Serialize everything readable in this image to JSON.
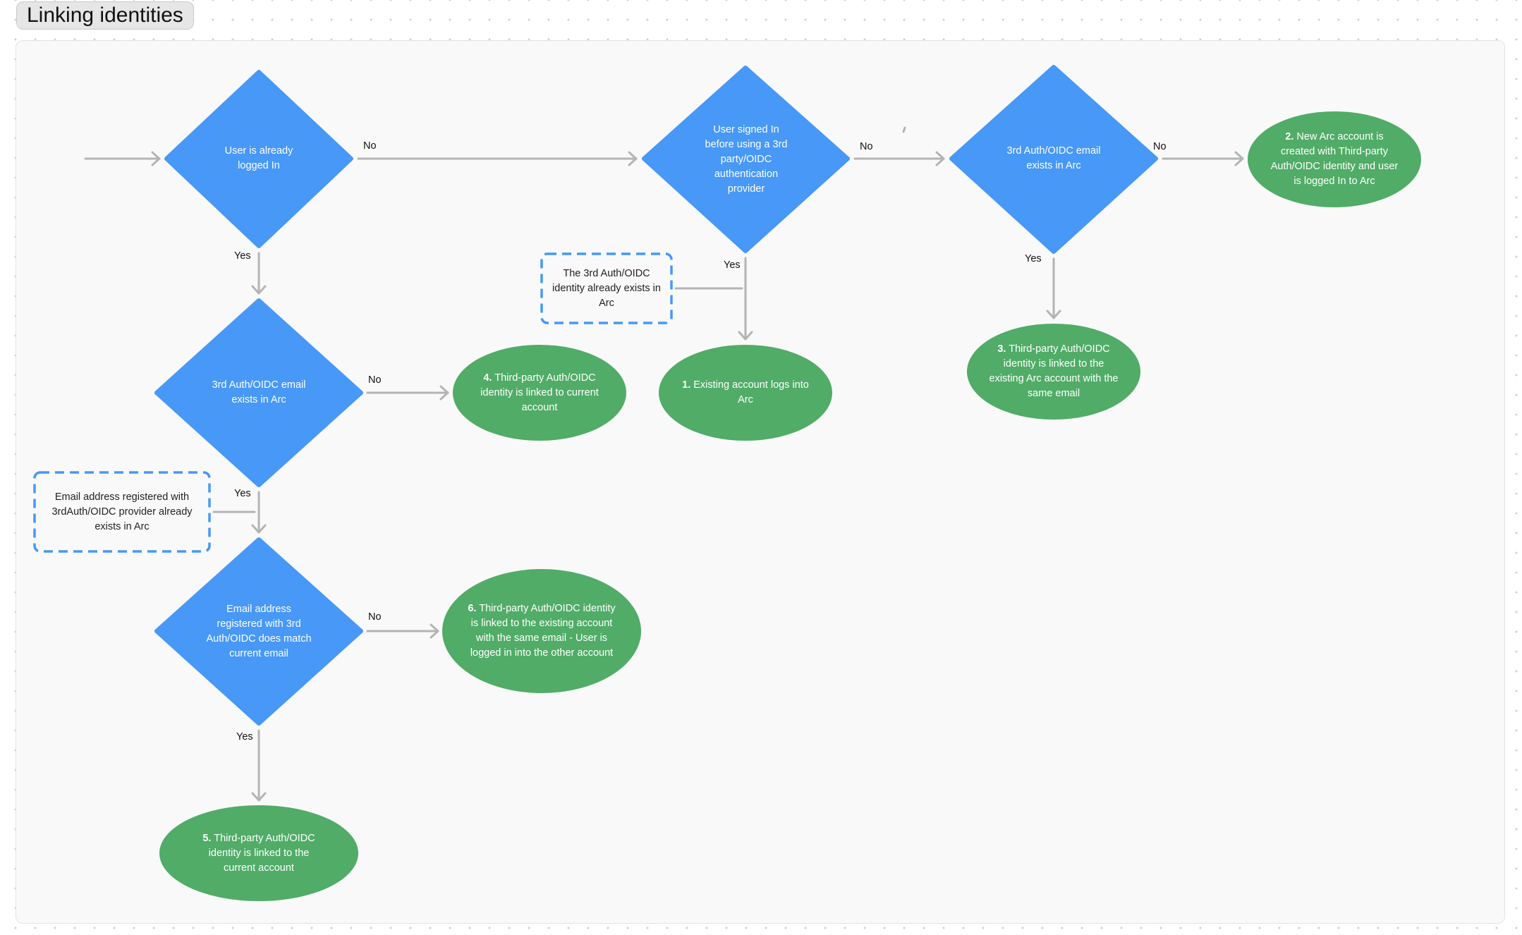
{
  "board": {
    "title": "Linking identities"
  },
  "colors": {
    "decision": "#4798f7",
    "outcome": "#50ac67",
    "note_border": "#4798f7",
    "connector": "#b4b4b4",
    "frame_bg": "#f9f9f9"
  },
  "decisions": [
    {
      "id": "d1",
      "text": "User is already logged In"
    },
    {
      "id": "d2",
      "text": "User signed In before using a 3rd party/OIDC authentication provider"
    },
    {
      "id": "d3",
      "text": "3rd Auth/OIDC email exists in Arc"
    },
    {
      "id": "d4",
      "text": "3rd Auth/OIDC email exists in Arc"
    },
    {
      "id": "d5",
      "text": "Email address registered with 3rd Auth/OIDC does match current email"
    }
  ],
  "outcomes": [
    {
      "id": "o1",
      "number": "1.",
      "text": "Existing account logs into Arc"
    },
    {
      "id": "o2",
      "number": "2.",
      "text": "New Arc account is created with Third-party Auth/OIDC identity and user is logged In to Arc"
    },
    {
      "id": "o3",
      "number": "3.",
      "text": "Third-party Auth/OIDC identity is linked to the existing Arc account with the same email"
    },
    {
      "id": "o4",
      "number": "4.",
      "text": "Third-party Auth/OIDC identity is linked to current account"
    },
    {
      "id": "o5",
      "number": "5.",
      "text": "Third-party Auth/OIDC identity is linked to the current account"
    },
    {
      "id": "o6",
      "number": "6.",
      "text": "Third-party Auth/OIDC identity is linked to the existing account with the same email - User is logged in into the other account"
    }
  ],
  "notes": [
    {
      "id": "n1",
      "text": "The 3rd Auth/OIDC identity already exists in Arc"
    },
    {
      "id": "n2",
      "text": "Email address registered with 3rdAuth/OIDC provider already exists in Arc"
    }
  ],
  "edges": [
    {
      "from": "start",
      "to": "d1",
      "label": ""
    },
    {
      "from": "d1",
      "to": "d2",
      "label": "No"
    },
    {
      "from": "d1",
      "to": "d4",
      "label": "Yes"
    },
    {
      "from": "d2",
      "to": "d3",
      "label": "No"
    },
    {
      "from": "d2",
      "to": "o1",
      "label": "Yes"
    },
    {
      "from": "d3",
      "to": "o2",
      "label": "No"
    },
    {
      "from": "d3",
      "to": "o3",
      "label": "Yes"
    },
    {
      "from": "d4",
      "to": "o4",
      "label": "No"
    },
    {
      "from": "d4",
      "to": "d5",
      "label": "Yes"
    },
    {
      "from": "d5",
      "to": "o6",
      "label": "No"
    },
    {
      "from": "d5",
      "to": "o5",
      "label": "Yes"
    }
  ],
  "edge_labels": {
    "yes": "Yes",
    "no": "No"
  }
}
